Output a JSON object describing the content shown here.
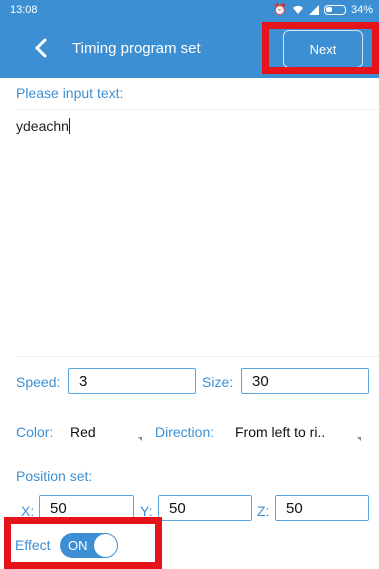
{
  "status": {
    "time": "13:08",
    "battery": "34%"
  },
  "header": {
    "title": "Timing program set",
    "next_label": "Next"
  },
  "form": {
    "prompt": "Please input text:",
    "text_value": "ydeachn",
    "speed_label": "Speed:",
    "speed_value": "3",
    "size_label": "Size:",
    "size_value": "30",
    "color_label": "Color:",
    "color_value": "Red",
    "direction_label": "Direction:",
    "direction_value": "From left to ri..",
    "position_label": "Position set:",
    "x_label": "X:",
    "x_value": "50",
    "y_label": "Y:",
    "y_value": "50",
    "z_label": "Z:",
    "z_value": "50",
    "effect_label": "Effect",
    "effect_state": "ON"
  },
  "colors": {
    "accent": "#3d8fd3",
    "highlight": "#e5141b"
  }
}
